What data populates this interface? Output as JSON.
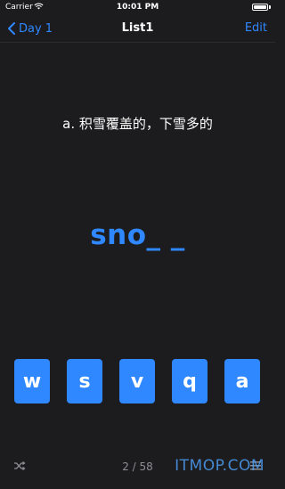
{
  "status_bar": {
    "carrier": "Carrier",
    "time": "10:01 PM",
    "battery_level": 1.0
  },
  "nav": {
    "back_label": "Day 1",
    "title": "List1",
    "edit_label": "Edit"
  },
  "quiz": {
    "prompt": "a. 积雪覆盖的，下雪多的",
    "word_display": "sno_ _",
    "letter_keys": [
      "w",
      "s",
      "v",
      "q",
      "a"
    ]
  },
  "footer": {
    "page_counter": "2 / 58",
    "watermark": "ITMOP.COM"
  },
  "colors": {
    "accent": "#2f88ff",
    "background": "#1c1c1e",
    "muted": "#8e8e93"
  },
  "icons": {
    "wifi": "wifi-icon",
    "battery": "battery-icon",
    "back": "chevron-left-icon",
    "shuffle": "shuffle-icon",
    "list": "list-icon"
  }
}
